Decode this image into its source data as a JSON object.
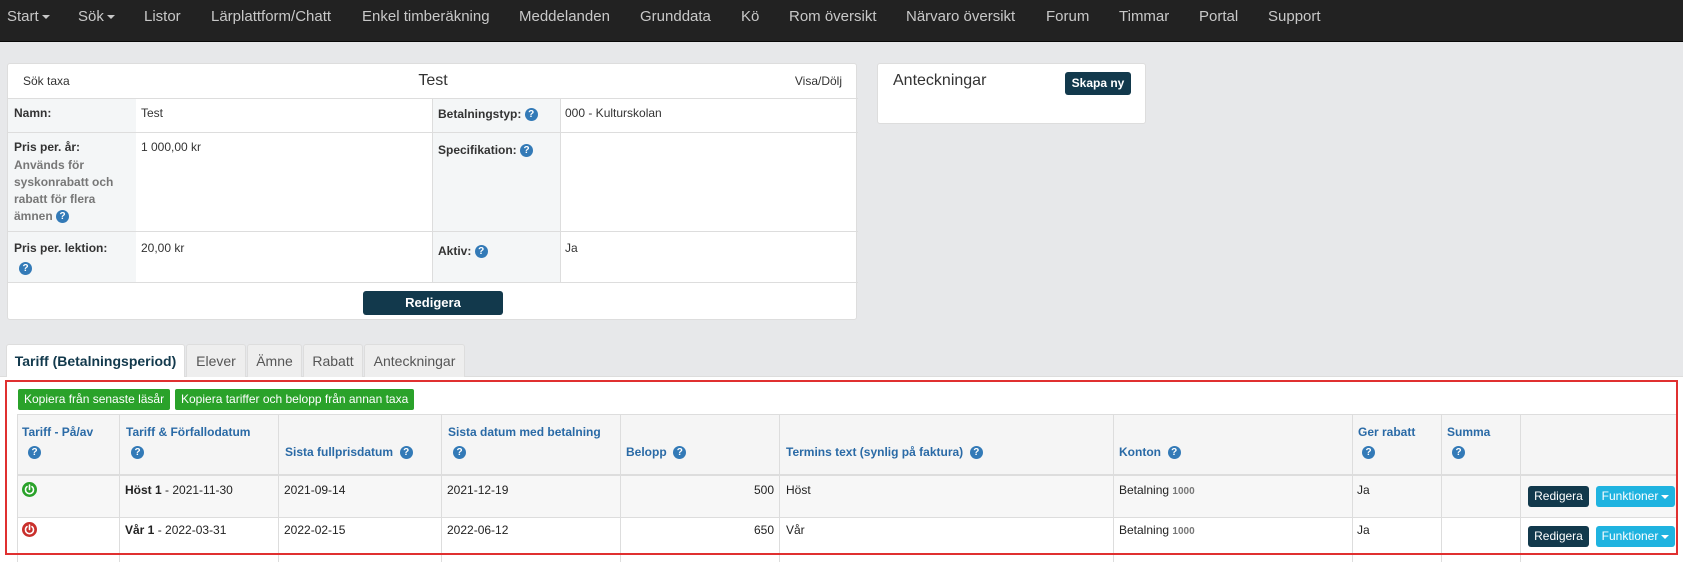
{
  "nav": {
    "start": "Start",
    "sok": "Sök",
    "listor": "Listor",
    "larplattform": "Lärplattform/Chatt",
    "timberakning": "Enkel timberäkning",
    "meddelanden": "Meddelanden",
    "grunddata": "Grunddata",
    "ko": "Kö",
    "rom": "Rom översikt",
    "narvaro": "Närvaro översikt",
    "forum": "Forum",
    "timmar": "Timmar",
    "portal": "Portal",
    "support": "Support"
  },
  "taxa": {
    "search_link": "Sök taxa",
    "title": "Test",
    "toggle": "Visa/Dölj",
    "namn_label": "Namn:",
    "namn_value": "Test",
    "betalningstyp_label": "Betalningstyp:",
    "betalningstyp_value": "000 - Kulturskolan",
    "pris_ar_label": "Pris per. år:",
    "pris_ar_note": "Används för syskonrabatt och rabatt för flera ämnen",
    "pris_ar_value": "1 000,00 kr",
    "specifikation_label": "Specifikation:",
    "specifikation_value": "",
    "pris_lektion_label": "Pris per. lektion:",
    "pris_lektion_value": "20,00 kr",
    "aktiv_label": "Aktiv:",
    "aktiv_value": "Ja",
    "edit_button": "Redigera"
  },
  "notes": {
    "title": "Anteckningar",
    "create_button": "Skapa ny"
  },
  "tabs": [
    "Tariff (Betalningsperiod)",
    "Elever",
    "Ämne",
    "Rabatt",
    "Anteckningar"
  ],
  "tariff": {
    "copy_last_year": "Kopiera från senaste läsår",
    "copy_from_other": "Kopiera tariffer och belopp från annan taxa",
    "headers": {
      "pa_av": "Tariff - På/av",
      "tariff_forfall": "Tariff & Förfallodatum",
      "sista_fullpris": "Sista fullprisdatum",
      "sista_betalning": "Sista datum med betalning",
      "belopp": "Belopp",
      "termins_text": "Termins text (synlig på faktura)",
      "konton": "Konton",
      "ger_rabatt": "Ger rabatt",
      "summa": "Summa"
    },
    "rows": [
      {
        "status": "on",
        "name": "Höst 1",
        "due": " - 2021-11-30",
        "sista_fullpris": "2021-09-14",
        "sista_betalning": "2021-12-19",
        "belopp": "500",
        "termins_text": "Höst",
        "konto": "Betalning",
        "konto_nr": "1000",
        "ger_rabatt": "Ja",
        "summa": "",
        "edit": "Redigera",
        "functions": "Funktioner"
      },
      {
        "status": "off",
        "name": "Vår 1",
        "due": " - 2022-03-31",
        "sista_fullpris": "2022-02-15",
        "sista_betalning": "2022-06-12",
        "belopp": "650",
        "termins_text": "Vår",
        "konto": "Betalning",
        "konto_nr": "1000",
        "ger_rabatt": "Ja",
        "summa": "",
        "edit": "Redigera",
        "functions": "Funktioner"
      }
    ]
  },
  "colors": {
    "nav_bg": "#222222",
    "dark_button": "#12394c",
    "green_button": "#2aa22a",
    "info_button": "#1fb3e0",
    "power_on": "#2aa22a",
    "power_off": "#c9302c",
    "highlight_border": "#e03030"
  }
}
